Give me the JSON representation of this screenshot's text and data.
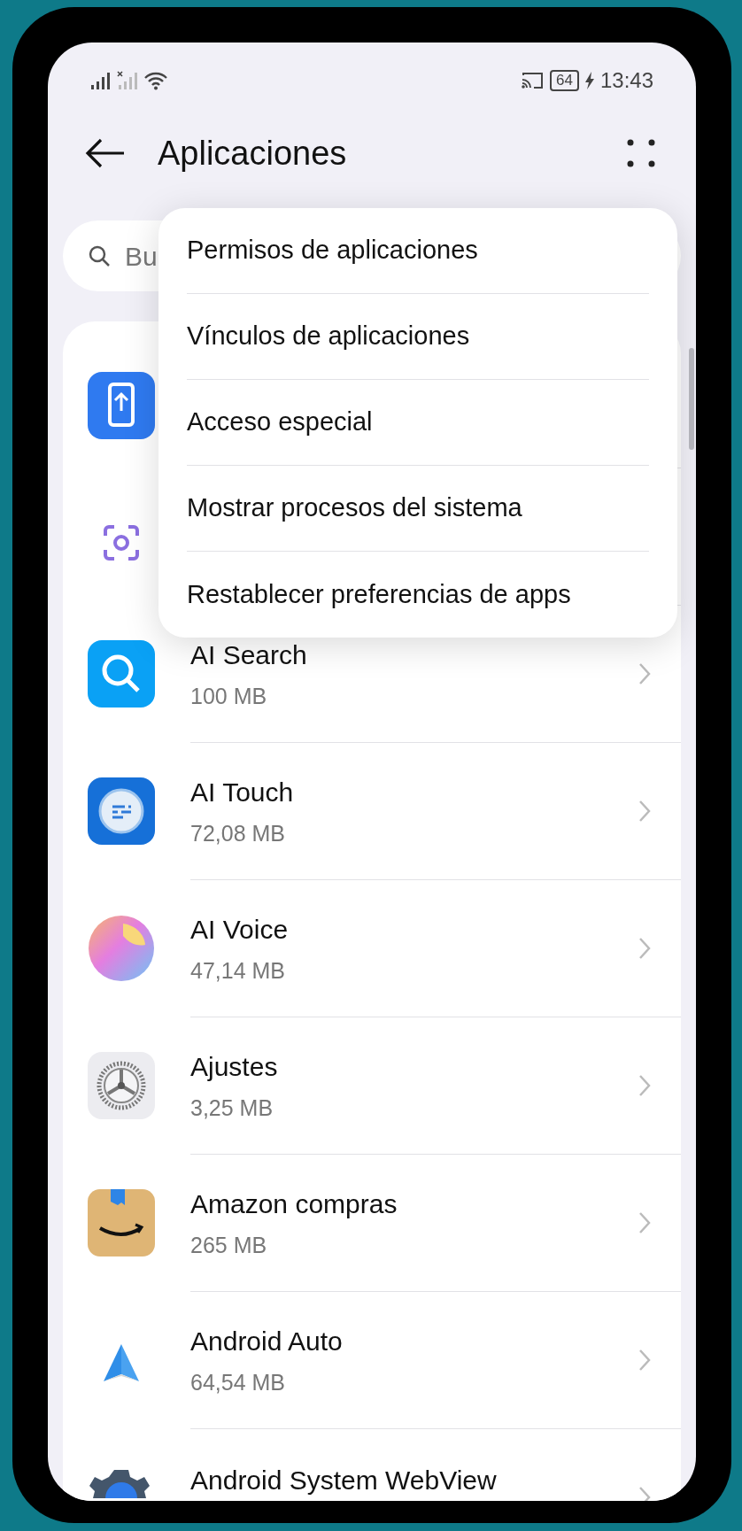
{
  "status_bar": {
    "battery": "64",
    "time": "13:43"
  },
  "header": {
    "title": "Aplicaciones"
  },
  "search": {
    "placeholder": "Bu"
  },
  "menu": {
    "items": [
      {
        "label": "Permisos de aplicaciones"
      },
      {
        "label": "Vínculos de aplicaciones"
      },
      {
        "label": "Acceso especial"
      },
      {
        "label": "Mostrar procesos del sistema"
      },
      {
        "label": "Restablecer preferencias de apps"
      }
    ]
  },
  "apps": [
    {
      "kind": "phone-transfer"
    },
    {
      "kind": "scan"
    },
    {
      "kind": "search",
      "name": "AI Search",
      "size": "100 MB"
    },
    {
      "kind": "touch",
      "name": "AI Touch",
      "size": "72,08 MB"
    },
    {
      "kind": "voice",
      "name": "AI Voice",
      "size": "47,14 MB"
    },
    {
      "kind": "settings",
      "name": "Ajustes",
      "size": "3,25 MB"
    },
    {
      "kind": "box",
      "name": "Amazon compras",
      "size": "265 MB"
    },
    {
      "kind": "auto",
      "name": "Android Auto",
      "size": "64,54 MB"
    },
    {
      "kind": "gear",
      "name": "Android System WebView"
    }
  ]
}
